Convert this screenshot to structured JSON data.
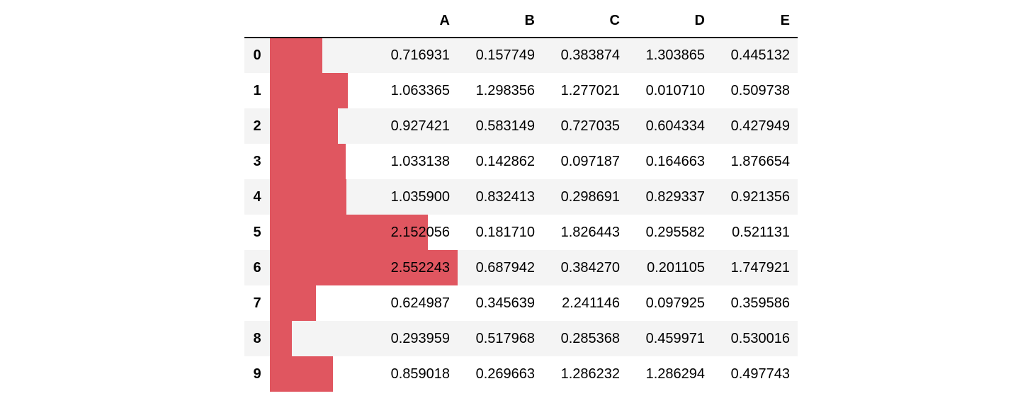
{
  "table": {
    "columns": [
      "A",
      "B",
      "C",
      "D",
      "E"
    ],
    "bar_color": "#e05660",
    "bar_column": "A",
    "bar_max_value": 2.552243,
    "rows": [
      {
        "index": "0",
        "values": [
          "0.716931",
          "0.157749",
          "0.383874",
          "1.303865",
          "0.445132"
        ],
        "bar_value": 0.716931
      },
      {
        "index": "1",
        "values": [
          "1.063365",
          "1.298356",
          "1.277021",
          "0.010710",
          "0.509738"
        ],
        "bar_value": 1.063365
      },
      {
        "index": "2",
        "values": [
          "0.927421",
          "0.583149",
          "0.727035",
          "0.604334",
          "0.427949"
        ],
        "bar_value": 0.927421
      },
      {
        "index": "3",
        "values": [
          "1.033138",
          "0.142862",
          "0.097187",
          "0.164663",
          "1.876654"
        ],
        "bar_value": 1.033138
      },
      {
        "index": "4",
        "values": [
          "1.035900",
          "0.832413",
          "0.298691",
          "0.829337",
          "0.921356"
        ],
        "bar_value": 1.0359
      },
      {
        "index": "5",
        "values": [
          "2.152056",
          "0.181710",
          "1.826443",
          "0.295582",
          "0.521131"
        ],
        "bar_value": 2.152056
      },
      {
        "index": "6",
        "values": [
          "2.552243",
          "0.687942",
          "0.384270",
          "0.201105",
          "1.747921"
        ],
        "bar_value": 2.552243
      },
      {
        "index": "7",
        "values": [
          "0.624987",
          "0.345639",
          "2.241146",
          "0.097925",
          "0.359586"
        ],
        "bar_value": 0.624987
      },
      {
        "index": "8",
        "values": [
          "0.293959",
          "0.517968",
          "0.285368",
          "0.459971",
          "0.530016"
        ],
        "bar_value": 0.293959
      },
      {
        "index": "9",
        "values": [
          "0.859018",
          "0.269663",
          "1.286232",
          "1.286294",
          "0.497743"
        ],
        "bar_value": 0.859018
      }
    ]
  }
}
